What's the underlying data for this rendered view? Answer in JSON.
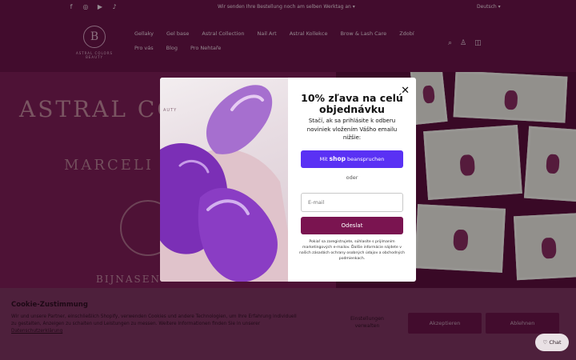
{
  "topbar": {
    "social_icons": [
      "facebook-icon",
      "instagram-icon",
      "youtube-icon",
      "tiktok-icon"
    ],
    "announcement": "Wir senden Ihre Bestellung noch am selben Werktag an ▾",
    "language": "Deutsch ▾"
  },
  "header": {
    "logo_text": "ASTRAL COLORS BEAUTY",
    "logo_mark": "B",
    "nav": [
      "Gellaky",
      "Gel base",
      "Astral Collection",
      "Nail Art",
      "Astral Kollekce",
      "Brow & Lash Care",
      "Zdobí",
      "Pro vás",
      "Blog",
      "Pro Nehtaře"
    ],
    "icons": [
      "search-icon",
      "user-icon",
      "bag-icon"
    ]
  },
  "hero": {
    "title": "ASTRAL CO",
    "subtitle": "MARCELI",
    "bottom": "BIJNASEN"
  },
  "modal": {
    "image_brand": "AUTY",
    "title": "10% zľava na celú objednávku",
    "description": "Stačí, ak sa prihlásite k odberu noviniek vložením Vášho emailu nižšie:",
    "shop_button_prefix": "Mit",
    "shop_button_brand": "shop",
    "shop_button_suffix": "beanspruchen",
    "divider": "oder",
    "email_placeholder": "E-mail",
    "submit": "Odeslat",
    "legal": "Pokiaľ sa zaregistrujete, súhlasíte s prijímaním marketingových e-mailov. Ďalšie informácie nájdete v našich zásadách ochrany osobných údajov a obchodných podmienkach."
  },
  "cookie": {
    "title": "Cookie-Zustimmung",
    "text": "Wir und unsere Partner, einschließlich Shopify, verwenden Cookies und andere Technologien, um Ihre Erfahrung individuell zu gestalten, Anzeigen zu schalten und Leistungen zu messen. Weitere Informationen finden Sie in unserer",
    "link": "Datenschutzerklärung",
    "settings": "Einstellungen verwalten",
    "accept": "Akzeptieren",
    "decline": "Ablehnen",
    "accent": "#6b1449"
  },
  "chat": {
    "label": "Chat"
  }
}
